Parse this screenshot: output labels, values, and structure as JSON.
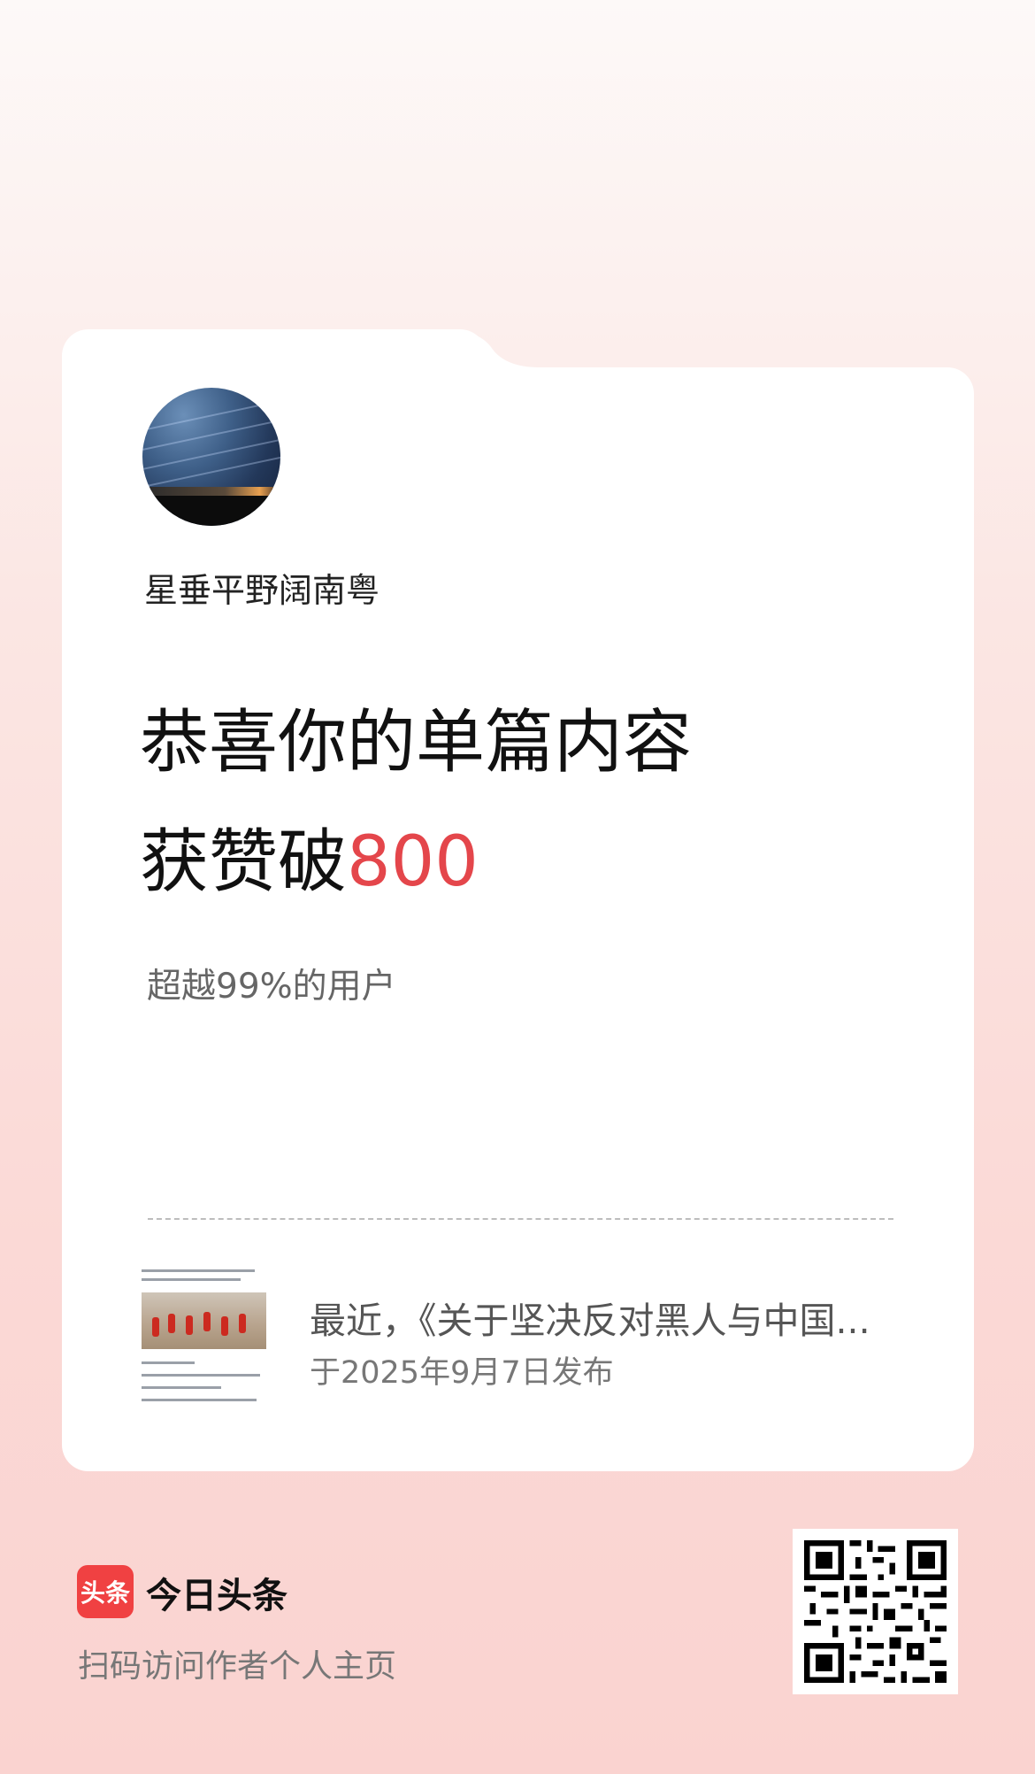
{
  "author": {
    "name": "星垂平野阔南粤"
  },
  "headline": {
    "line1": "恭喜你的单篇内容",
    "line2_prefix": "获赞破",
    "line2_number": "800"
  },
  "subline": "超越99%的用户",
  "article": {
    "title": "最近，《关于坚决反对黑人与中国...",
    "date": "于2025年9月7日发布"
  },
  "footer": {
    "logo_text": "头条",
    "app_name": "今日头条",
    "scan_text": "扫码访问作者个人主页"
  },
  "colors": {
    "accent": "#e4464b",
    "logo": "#f04142"
  },
  "icons": {
    "avatar": "night-sky-avatar",
    "qr": "qr-code-icon"
  }
}
